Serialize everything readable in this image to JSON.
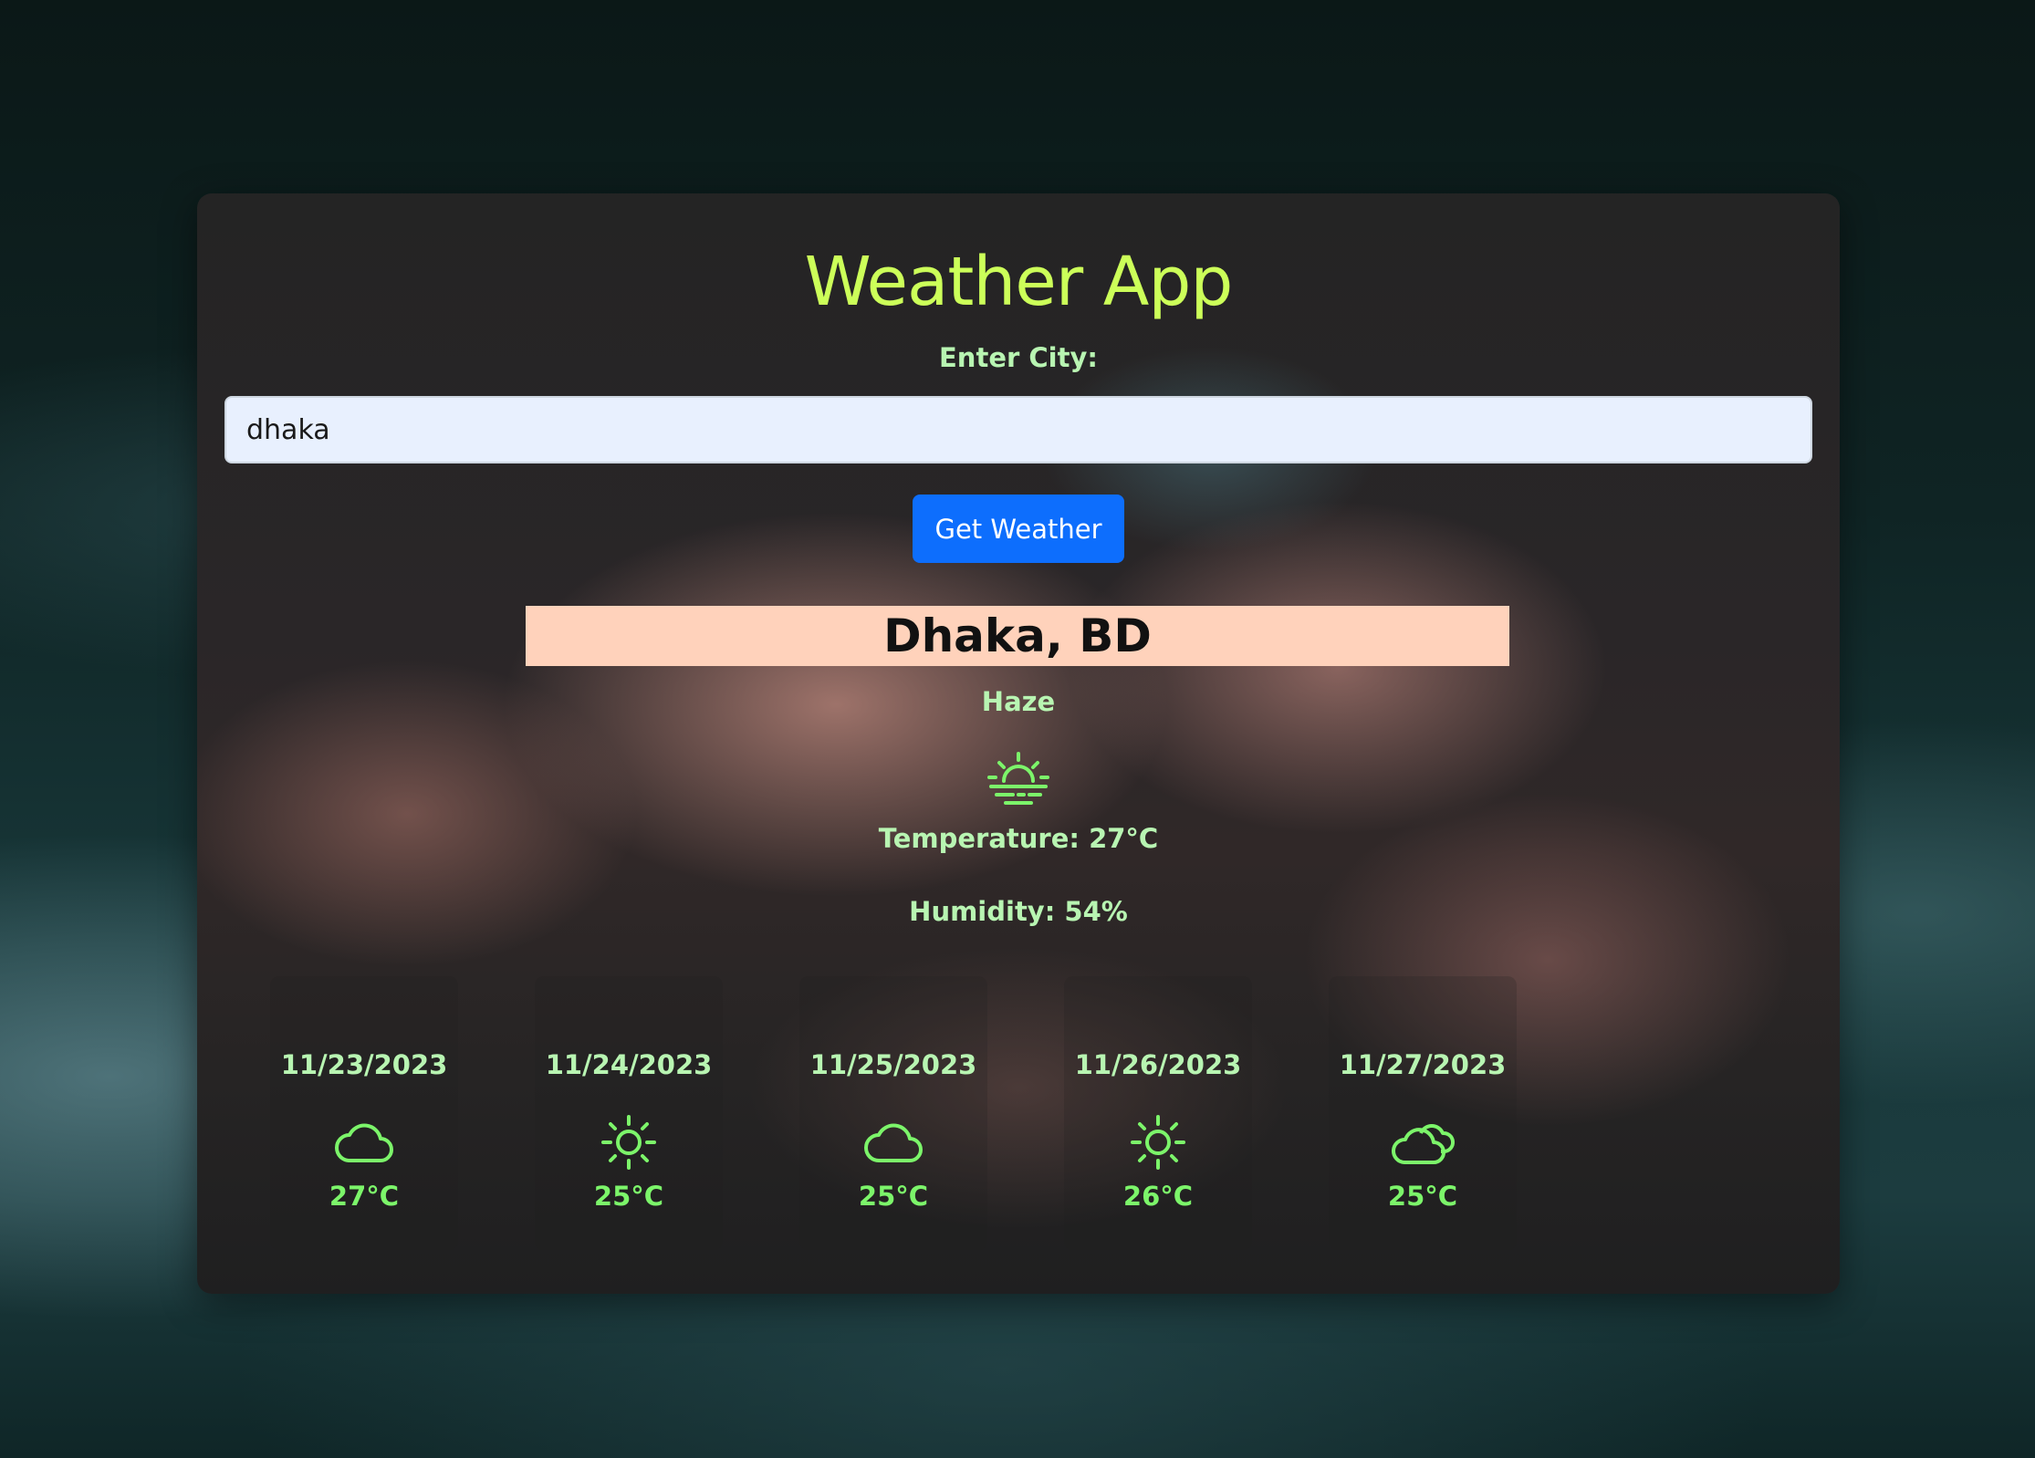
{
  "app": {
    "title": "Weather App"
  },
  "search": {
    "label": "Enter City:",
    "value": "dhaka",
    "button_label": "Get Weather"
  },
  "current": {
    "location": "Dhaka, BD",
    "condition": "Haze",
    "icon": "haze-sunrise-icon",
    "temperature_text": "Temperature: 27°C",
    "humidity_text": "Humidity: 54%"
  },
  "forecast": [
    {
      "date": "11/23/2023",
      "icon": "cloud-icon",
      "temp": "27°C"
    },
    {
      "date": "11/24/2023",
      "icon": "sun-icon",
      "temp": "25°C"
    },
    {
      "date": "11/25/2023",
      "icon": "cloud-icon",
      "temp": "25°C"
    },
    {
      "date": "11/26/2023",
      "icon": "sun-icon",
      "temp": "26°C"
    },
    {
      "date": "11/27/2023",
      "icon": "clouds-icon",
      "temp": "25°C"
    }
  ],
  "colors": {
    "title": "#ccff59",
    "text": "#b8f5b2",
    "icon": "#7cf56a",
    "button": "#0d6efd",
    "location_bg": "#ffd2bb"
  }
}
